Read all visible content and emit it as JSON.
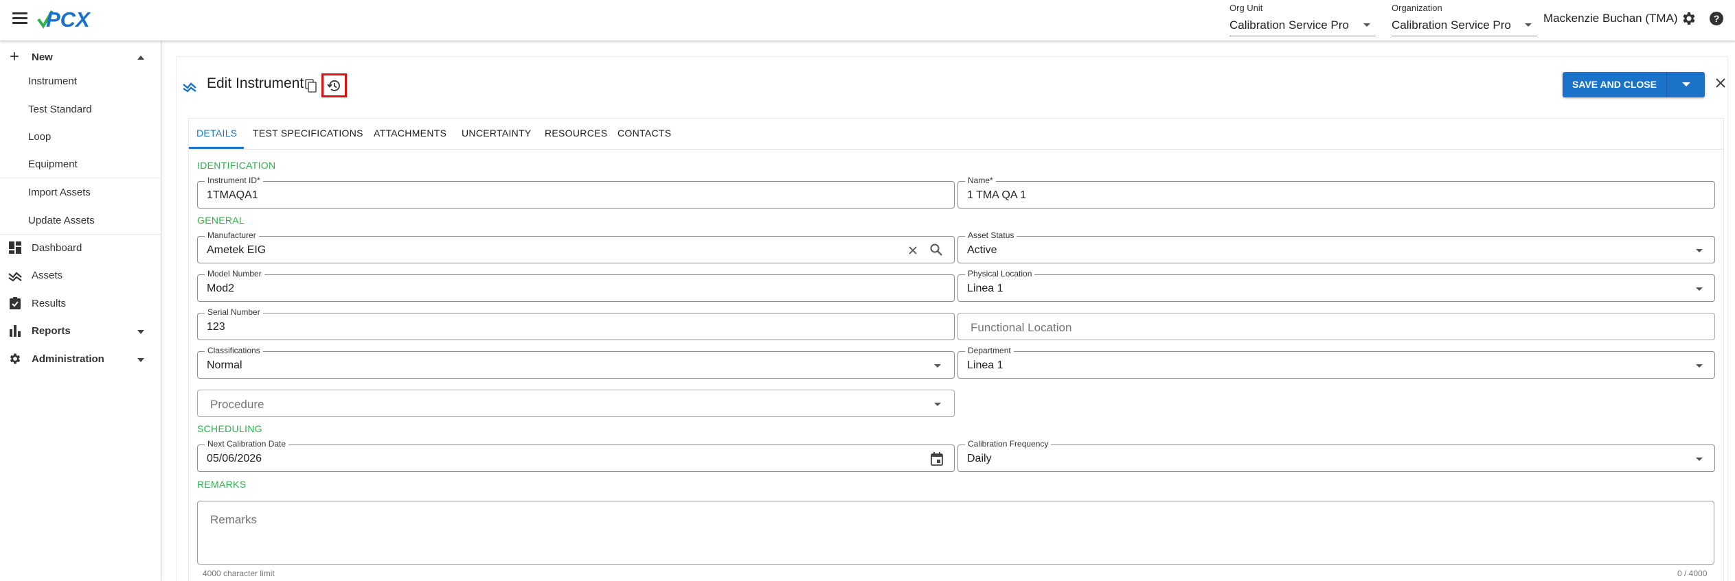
{
  "header": {
    "org_unit_label": "Org Unit",
    "org_unit_value": "Calibration Service Pro",
    "organization_label": "Organization",
    "organization_value": "Calibration Service Pro",
    "user": "Mackenzie Buchan (TMA)",
    "logo_text": "PCX",
    "colors": {
      "logo_blue": "#1a73c9",
      "logo_green": "#2bb24c"
    }
  },
  "sidebar": {
    "new_label": "New",
    "new_items": [
      "Instrument",
      "Test Standard",
      "Loop",
      "Equipment"
    ],
    "import_items": [
      "Import Assets",
      "Update Assets"
    ],
    "main_items": [
      "Dashboard",
      "Assets",
      "Results",
      "Reports",
      "Administration"
    ]
  },
  "page": {
    "title": "Edit Instrument",
    "save_label": "SAVE AND CLOSE",
    "accent_color": "#1a73c9",
    "highlight_color": "#e01010"
  },
  "tabs": [
    "DETAILS",
    "TEST SPECIFICATIONS",
    "ATTACHMENTS",
    "UNCERTAINTY",
    "RESOURCES",
    "CONTACTS"
  ],
  "active_tab": "DETAILS",
  "sections": {
    "identification": "IDENTIFICATION",
    "general": "GENERAL",
    "scheduling": "SCHEDULING",
    "remarks": "REMARKS"
  },
  "fields": {
    "instrument_id": {
      "label": "Instrument ID*",
      "value": "1TMAQA1"
    },
    "name": {
      "label": "Name*",
      "value": "1 TMA QA 1"
    },
    "manufacturer": {
      "label": "Manufacturer",
      "value": "Ametek EIG"
    },
    "asset_status": {
      "label": "Asset Status",
      "value": "Active"
    },
    "model_number": {
      "label": "Model Number",
      "value": "Mod2"
    },
    "physical_location": {
      "label": "Physical Location",
      "value": "Linea 1"
    },
    "serial_number": {
      "label": "Serial Number",
      "value": "123"
    },
    "functional_location": {
      "placeholder": "Functional Location"
    },
    "classifications": {
      "label": "Classifications",
      "value": "Normal"
    },
    "department": {
      "label": "Department",
      "value": "Linea 1"
    },
    "procedure": {
      "placeholder": "Procedure"
    },
    "next_calibration_date": {
      "label": "Next Calibration Date",
      "value": "05/06/2026"
    },
    "calibration_frequency": {
      "label": "Calibration Frequency",
      "value": "Daily"
    },
    "remarks": {
      "placeholder": "Remarks",
      "hint": "4000 character limit",
      "counter": "0 / 4000"
    }
  }
}
